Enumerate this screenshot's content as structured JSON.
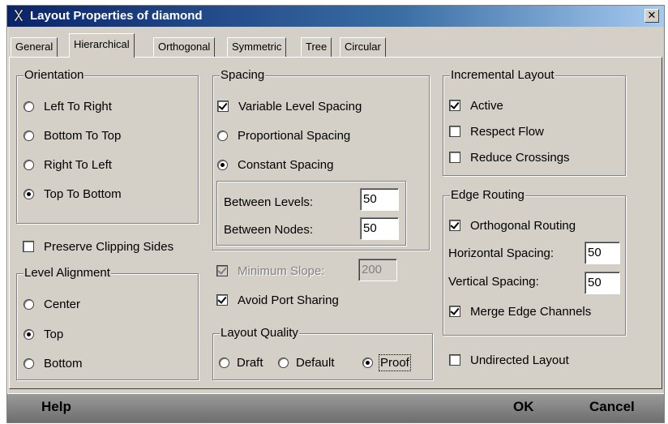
{
  "window": {
    "title": "Layout Properties of diamond",
    "close_glyph": "✕"
  },
  "tabs": [
    "General",
    "Hierarchical",
    "Orthogonal",
    "Symmetric",
    "Tree",
    "Circular"
  ],
  "active_tab": "Hierarchical",
  "orientation": {
    "legend": "Orientation",
    "options": [
      "Left To Right",
      "Bottom To Top",
      "Right To Left",
      "Top To Bottom"
    ],
    "selected": "Top To Bottom"
  },
  "preserve_clipping": {
    "label": "Preserve Clipping Sides",
    "checked": false
  },
  "level_alignment": {
    "legend": "Level Alignment",
    "options": [
      "Center",
      "Top",
      "Bottom"
    ],
    "selected": "Top"
  },
  "spacing": {
    "legend": "Spacing",
    "variable_level": {
      "label": "Variable Level Spacing",
      "checked": true
    },
    "proportional": {
      "label": "Proportional Spacing",
      "selected": false
    },
    "constant": {
      "label": "Constant Spacing",
      "selected": true
    },
    "between_levels": {
      "label": "Between Levels:",
      "value": "50"
    },
    "between_nodes": {
      "label": "Between Nodes:",
      "value": "50"
    }
  },
  "minimum_slope": {
    "label": "Minimum Slope:",
    "value": "200",
    "checked": true,
    "enabled": false
  },
  "avoid_port_sharing": {
    "label": "Avoid Port Sharing",
    "checked": true
  },
  "layout_quality": {
    "legend": "Layout Quality",
    "options": [
      "Draft",
      "Default",
      "Proof"
    ],
    "selected": "Proof"
  },
  "incremental": {
    "legend": "Incremental Layout",
    "active": {
      "label": "Active",
      "checked": true
    },
    "respect_flow": {
      "label": "Respect Flow",
      "checked": false
    },
    "reduce_crossings": {
      "label": "Reduce Crossings",
      "checked": false
    }
  },
  "edge_routing": {
    "legend": "Edge Routing",
    "orthogonal": {
      "label": "Orthogonal Routing",
      "checked": true
    },
    "horizontal_spacing": {
      "label": "Horizontal Spacing:",
      "value": "50"
    },
    "vertical_spacing": {
      "label": "Vertical Spacing:",
      "value": "50"
    },
    "merge_channels": {
      "label": "Merge Edge Channels",
      "checked": true
    }
  },
  "undirected": {
    "label": "Undirected Layout",
    "checked": false
  },
  "buttons": {
    "help": "Help",
    "ok": "OK",
    "cancel": "Cancel"
  }
}
